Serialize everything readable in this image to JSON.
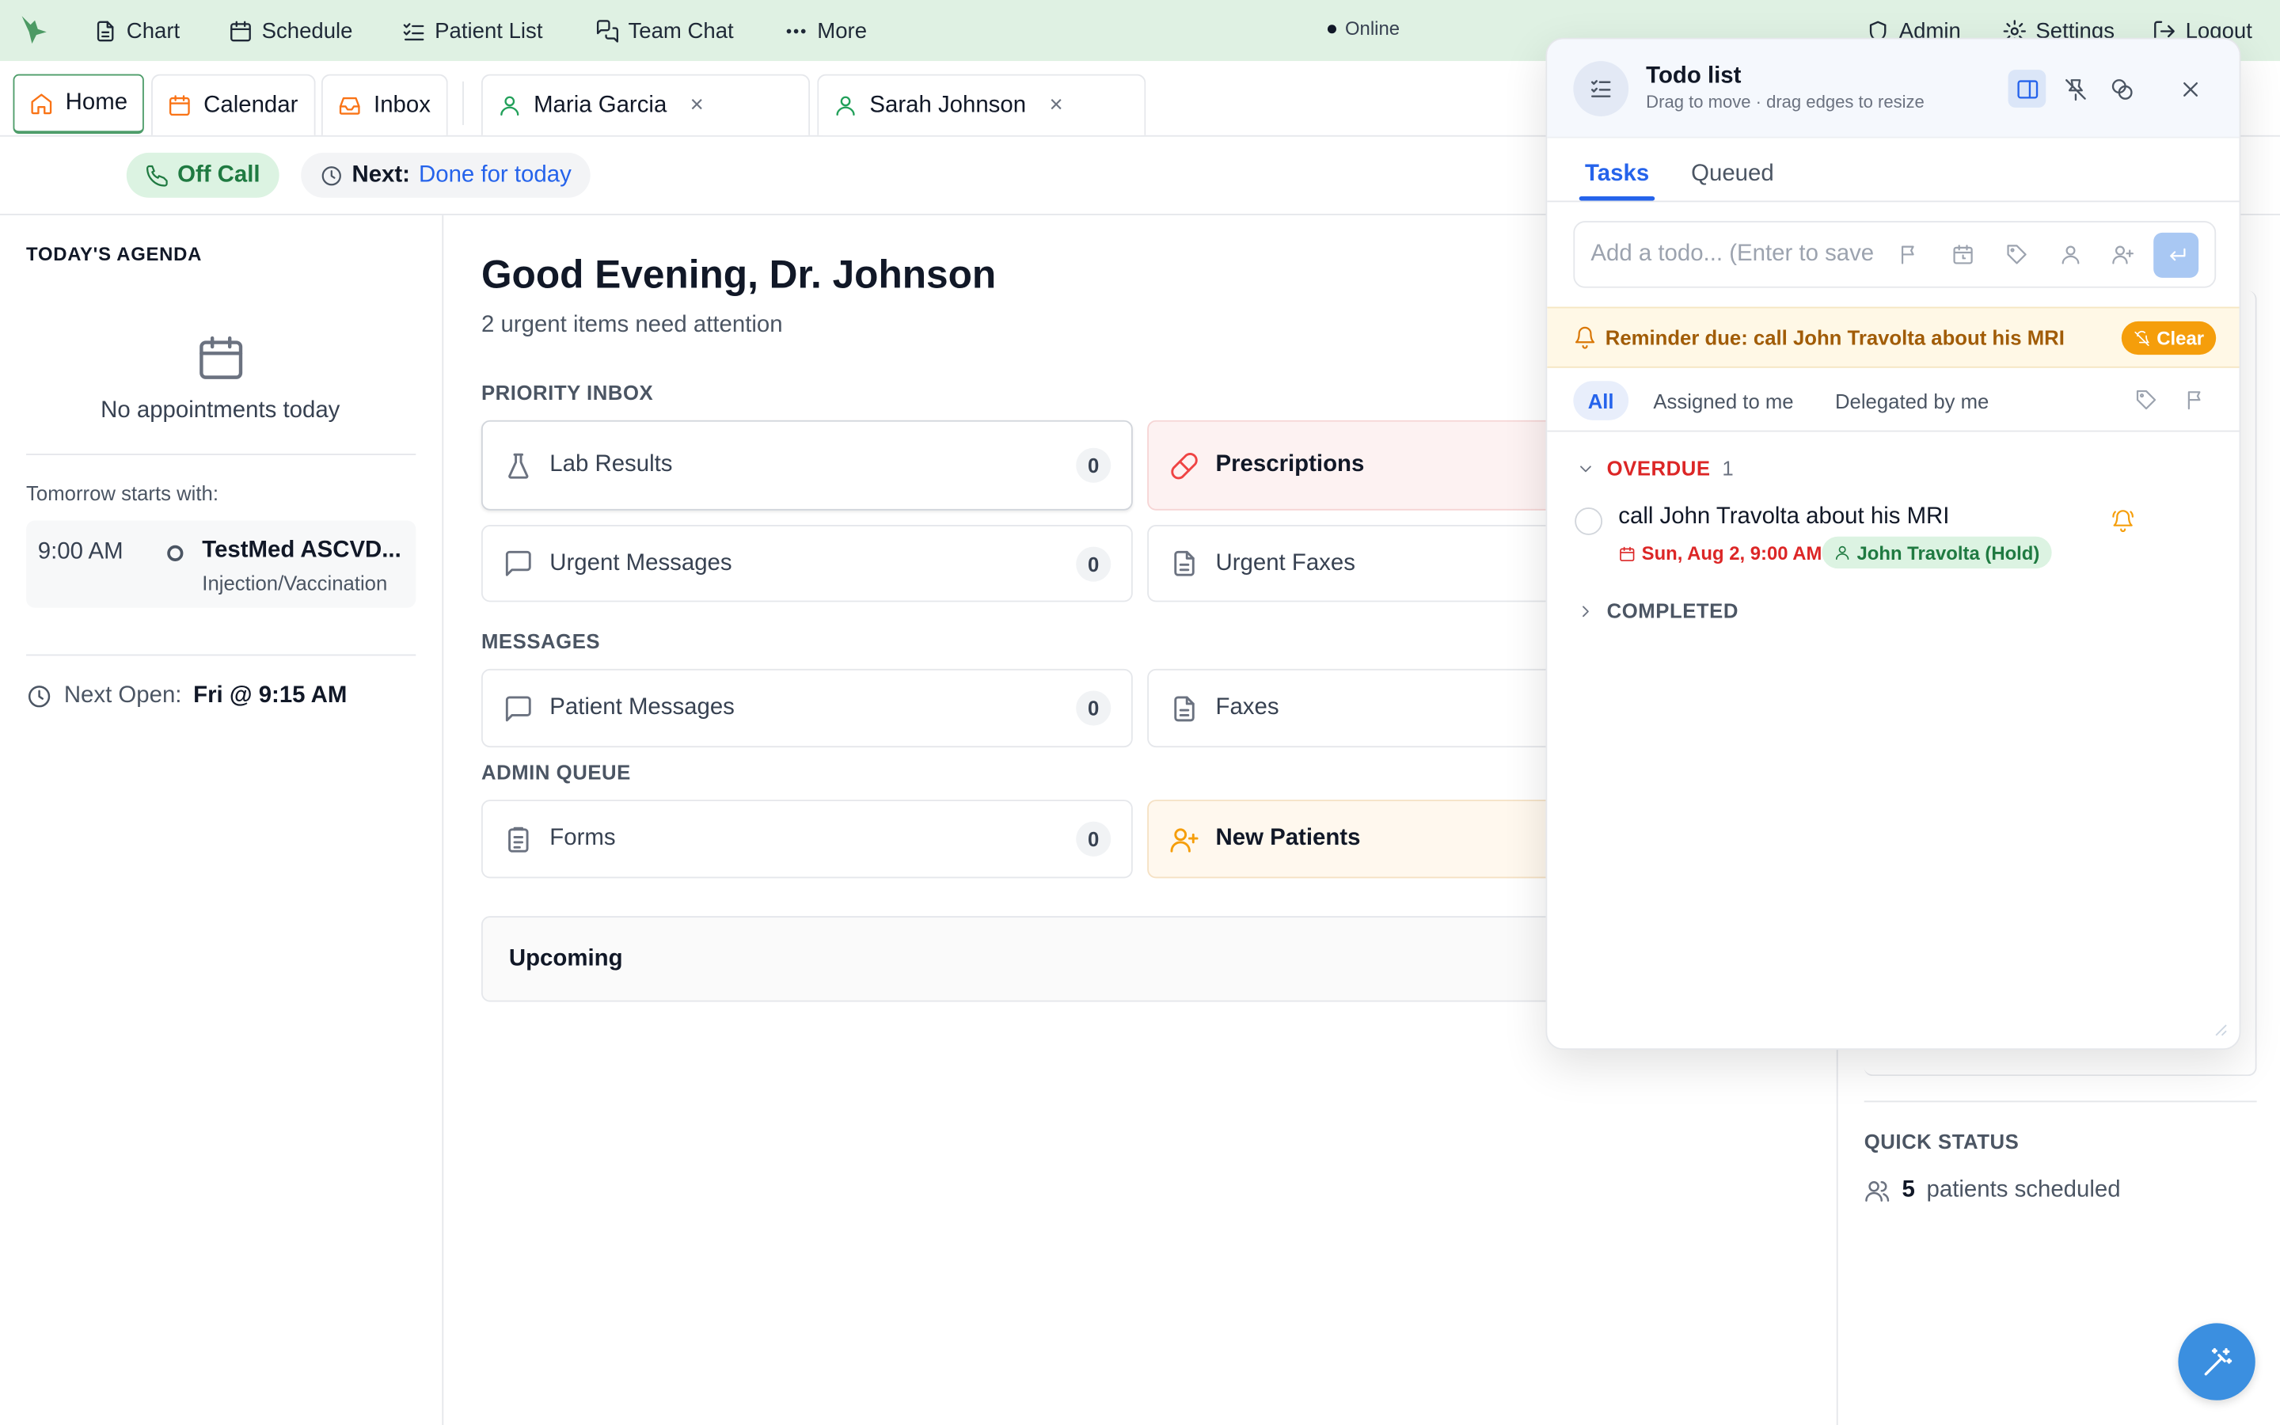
{
  "nav": {
    "items": [
      {
        "label": "Chart",
        "icon": "document-icon"
      },
      {
        "label": "Schedule",
        "icon": "calendar-icon"
      },
      {
        "label": "Patient List",
        "icon": "list-check-icon"
      },
      {
        "label": "Team Chat",
        "icon": "chat-icon"
      },
      {
        "label": "More",
        "icon": "dots-icon"
      }
    ],
    "status": "Online",
    "admin": "Admin",
    "settings": "Settings",
    "logout": "Logout"
  },
  "tabs": {
    "home": "Home",
    "calendar": "Calendar",
    "inbox": "Inbox",
    "patients": [
      "Maria Garcia",
      "Sarah Johnson"
    ],
    "close_glyph": "×"
  },
  "status": {
    "call": "Off Call",
    "next_label": "Next:",
    "next_value": "Done for today"
  },
  "agenda": {
    "title": "TODAY'S AGENDA",
    "empty": "No appointments today",
    "tomorrow_label": "Tomorrow starts with:",
    "appt_time": "9:00 AM",
    "appt_name": "TestMed ASCVD...",
    "appt_type": "Injection/Vaccination",
    "next_open_label": "Next Open:",
    "next_open_value": "Fri @ 9:15 AM"
  },
  "main": {
    "greeting": "Good Evening, Dr. Johnson",
    "subtitle": "2 urgent items need attention",
    "priority_title": "PRIORITY INBOX",
    "messages_title": "MESSAGES",
    "admin_title": "ADMIN QUEUE",
    "cards": {
      "lab_results": {
        "label": "Lab Results",
        "count": "0"
      },
      "prescriptions": {
        "label": "Prescriptions"
      },
      "urgent_messages": {
        "label": "Urgent Messages",
        "count": "0"
      },
      "urgent_faxes": {
        "label": "Urgent Faxes"
      },
      "patient_messages": {
        "label": "Patient Messages",
        "count": "0"
      },
      "faxes": {
        "label": "Faxes"
      },
      "forms": {
        "label": "Forms",
        "count": "0"
      },
      "new_patients": {
        "label": "New Patients"
      }
    },
    "upcoming": "Upcoming"
  },
  "quick_status": {
    "title": "QUICK STATUS",
    "count": "5",
    "label": "patients scheduled"
  },
  "todo": {
    "title": "Todo list",
    "hint": "Drag to move · drag edges to resize",
    "tabs": [
      "Tasks",
      "Queued"
    ],
    "input_placeholder": "Add a todo... (Enter to save",
    "reminder": "Reminder due: call John Travolta about his MRI",
    "clear": "Clear",
    "filters": [
      "All",
      "Assigned to me",
      "Delegated by me"
    ],
    "overdue_label": "OVERDUE",
    "overdue_count": "1",
    "task": {
      "title": "call John Travolta about his MRI",
      "due": "Sun, Aug 2, 9:00 AM",
      "assignee": "John Travolta (Hold)"
    },
    "completed_label": "COMPLETED"
  },
  "colors": {
    "nav_bg": "#dff1e3",
    "accent_green": "#4e9d6a",
    "accent_blue": "#2563eb",
    "overdue_red": "#dc2626",
    "reminder_amber": "#f59e0b"
  }
}
